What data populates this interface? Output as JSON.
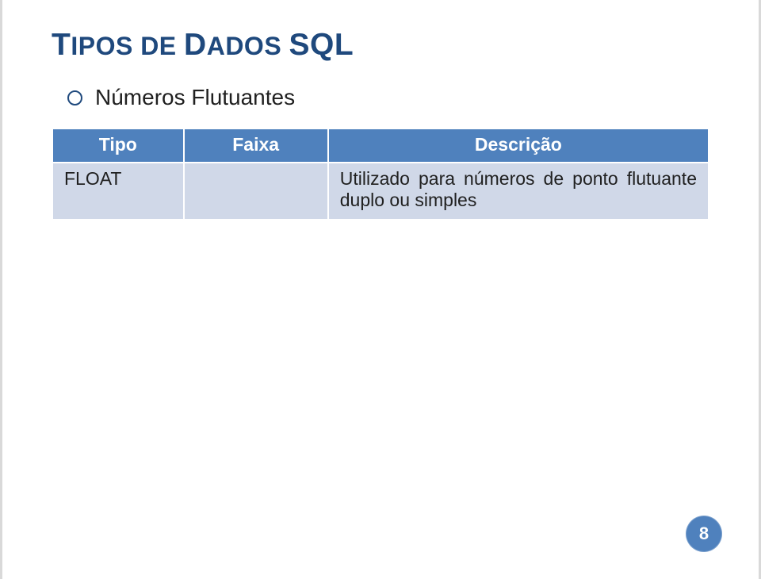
{
  "title_part1": "T",
  "title_part2": "IPOS DE ",
  "title_part3": "D",
  "title_part4": "ADOS ",
  "title_part5": "SQL",
  "bullet": "Números Flutuantes",
  "table": {
    "headers": {
      "tipo": "Tipo",
      "faixa": "Faixa",
      "descricao": "Descrição"
    },
    "rows": [
      {
        "tipo": "FLOAT",
        "faixa": "",
        "descricao": "Utilizado para números de ponto flutuante duplo ou simples"
      }
    ]
  },
  "page_number": "8"
}
